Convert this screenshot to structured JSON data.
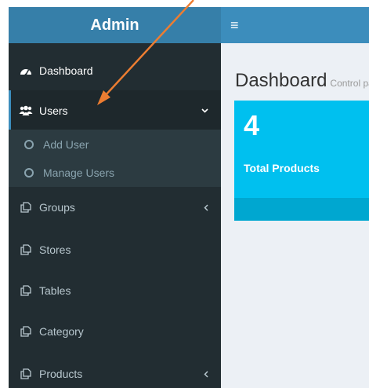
{
  "app": {
    "title": "Admin",
    "menu_toggle_icon": "hamburger-icon"
  },
  "sidebar": {
    "items": [
      {
        "label": "Dashboard",
        "icon": "dashboard-icon"
      },
      {
        "label": "Users",
        "icon": "users-icon",
        "chevron": "chevron-down-icon",
        "expanded": true
      },
      {
        "label": "Groups",
        "icon": "files-icon",
        "chevron": "chevron-left-icon"
      },
      {
        "label": "Stores",
        "icon": "files-icon"
      },
      {
        "label": "Tables",
        "icon": "files-icon"
      },
      {
        "label": "Category",
        "icon": "files-icon"
      },
      {
        "label": "Products",
        "icon": "files-icon",
        "chevron": "chevron-left-icon"
      }
    ],
    "users_submenu": [
      {
        "label": "Add User",
        "icon": "circle-icon"
      },
      {
        "label": "Manage Users",
        "icon": "circle-icon"
      }
    ]
  },
  "main": {
    "page_title": "Dashboard",
    "page_subtitle": "Control panel",
    "stat_box": {
      "value": "4",
      "label": "Total Products",
      "color": "#00c0ef"
    }
  },
  "colors": {
    "sidebar_bg": "#222d32",
    "logo_bg": "#367fa9",
    "topbar_bg": "#3c8dbc",
    "content_bg": "#ecf0f5",
    "annotation_arrow": "#ed7d31"
  }
}
